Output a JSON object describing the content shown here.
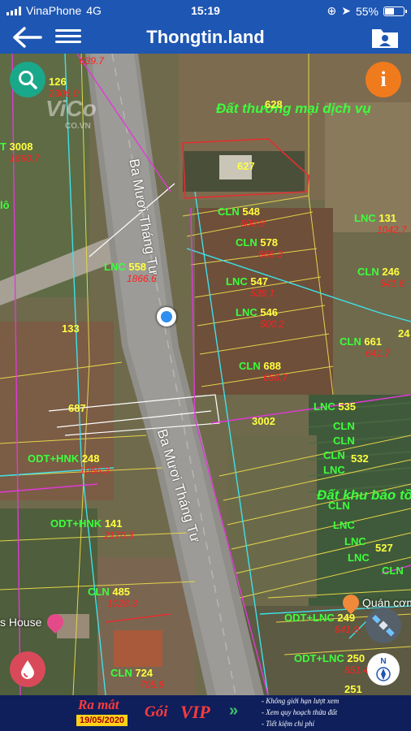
{
  "status_bar": {
    "carrier": "VinaPhone",
    "network": "4G",
    "time": "15:19",
    "battery": "55%",
    "battery_level": 0.55
  },
  "header": {
    "title": "Thongtin.land",
    "back_icon": "arrow-left-icon",
    "menu_icon": "hamburger-menu-icon",
    "profile_icon": "contact-folder-icon"
  },
  "watermark": {
    "main": "ViCo",
    "sub": "CO.VN"
  },
  "roads": [
    "Ba Mươi Tháng Tư",
    "Ba Mươi Tháng Tư"
  ],
  "zones": [
    "Đất thương mại dịch vụ",
    "Đất khu bảo tồ"
  ],
  "map_labels": [
    {
      "num": "126",
      "area": "2306.0"
    },
    {
      "num": "639.7"
    },
    {
      "num": "628"
    },
    {
      "code": "T",
      "num": "3008",
      "area": "1690.7"
    },
    {
      "num": "627"
    },
    {
      "code": "lô"
    },
    {
      "code": "CLN",
      "num": "548",
      "area": "600.9"
    },
    {
      "code": "LNC",
      "num": "131",
      "area": "1042.7"
    },
    {
      "code": "CLN",
      "num": "578",
      "area": "666.3"
    },
    {
      "code": "LNC",
      "num": "558",
      "area": "1866.6"
    },
    {
      "code": "CLN",
      "num": "246",
      "area": "541.6"
    },
    {
      "code": "LNC",
      "num": "547",
      "area": "539.1"
    },
    {
      "code": "LNC",
      "num": "546",
      "area": "500.2"
    },
    {
      "num": "133"
    },
    {
      "code": "CLN",
      "num": "661",
      "area": "641.7"
    },
    {
      "num": "24"
    },
    {
      "code": "CLN",
      "num": "688",
      "area": "666.7"
    },
    {
      "num": "687"
    },
    {
      "num": "3002"
    },
    {
      "code": "LNC",
      "num": "535"
    },
    {
      "code": "ODT+HNK",
      "num": "248",
      "area": "1066.3"
    },
    {
      "code": "ODT+HNK",
      "num": "141",
      "area": "2170.3"
    },
    {
      "code": "CLN",
      "num": "485",
      "area": "1028.3"
    },
    {
      "code": "ODT+LNC",
      "num": "249",
      "area": "641.9"
    },
    {
      "code": "ODT+LNC",
      "num": "250",
      "area": "651.4"
    },
    {
      "code": "CLN",
      "num": "724",
      "area": "705.8"
    },
    {
      "num": "251"
    },
    {
      "code": "CLN"
    },
    {
      "num": "532"
    },
    {
      "num": "527"
    }
  ],
  "stack_codes": [
    "CLN",
    "CLN",
    "CLN",
    "LNC",
    "CLN",
    "CLN",
    "CLN",
    "LNC",
    "LNC",
    "LNC",
    "LNC"
  ],
  "places": {
    "house": "s House",
    "restaurant": "Quán cơm"
  },
  "buttons": {
    "search_icon": "search-icon",
    "info_label": "i",
    "drop_icon": "water-drop-icon",
    "satellite_icon": "satellite-icon",
    "compass_label": "N"
  },
  "banner": {
    "launch": "Ra mắt",
    "date": "19/05/2020",
    "package": "Gói",
    "vip": "VIP",
    "features": [
      "- Không giới hạn lượt xem",
      "- Xem quy hoạch thửa đất",
      "- Tiết kiệm chi phí"
    ]
  },
  "colors": {
    "header": "#1e56b3",
    "land_code": "#3cff3c",
    "parcel_number": "#ffff40",
    "area": "#ff2020",
    "info": "#f07b1d",
    "search": "#1aa88a"
  }
}
